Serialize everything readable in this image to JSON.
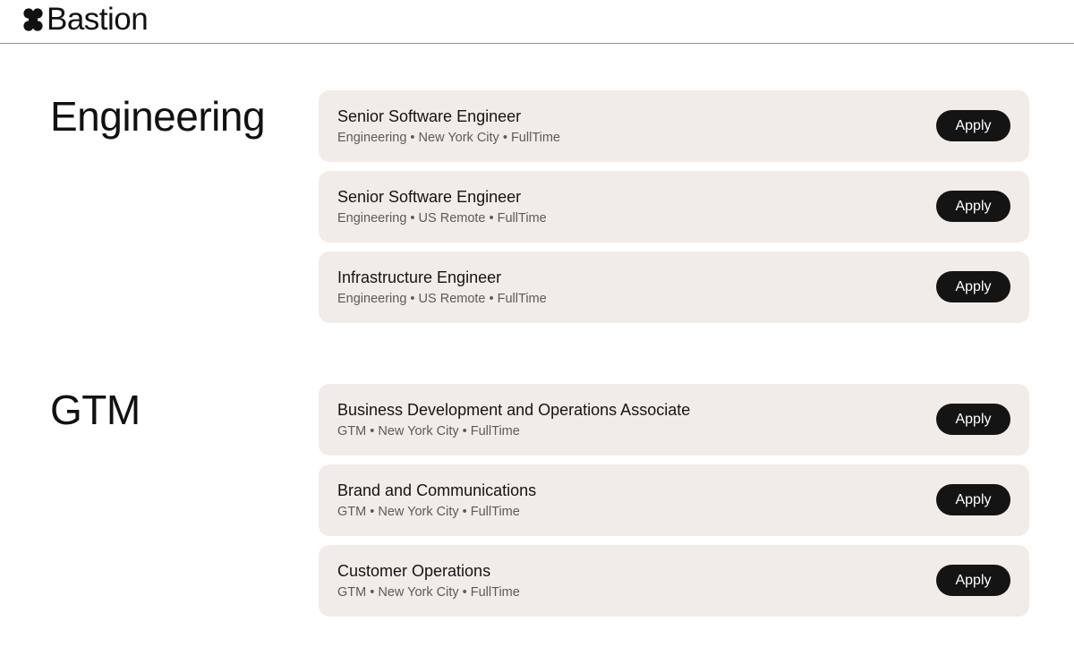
{
  "header": {
    "brand_name": "Bastion",
    "logo_icon": "four-petal-logo-icon"
  },
  "sections": [
    {
      "title": "Engineering",
      "jobs": [
        {
          "title": "Senior Software Engineer",
          "department": "Engineering",
          "location": "New York City",
          "type": "FullTime",
          "apply_label": "Apply"
        },
        {
          "title": "Senior Software Engineer",
          "department": "Engineering",
          "location": "US Remote",
          "type": "FullTime",
          "apply_label": "Apply"
        },
        {
          "title": "Infrastructure Engineer",
          "department": "Engineering",
          "location": "US Remote",
          "type": "FullTime",
          "apply_label": "Apply"
        }
      ]
    },
    {
      "title": "GTM",
      "jobs": [
        {
          "title": "Business Development and Operations Associate",
          "department": "GTM",
          "location": "New York City",
          "type": "FullTime",
          "apply_label": "Apply"
        },
        {
          "title": "Brand and Communications",
          "department": "GTM",
          "location": "New York City",
          "type": "FullTime",
          "apply_label": "Apply"
        },
        {
          "title": "Customer Operations",
          "department": "GTM",
          "location": "New York City",
          "type": "FullTime",
          "apply_label": "Apply"
        }
      ]
    }
  ],
  "meta_separator": " • ",
  "colors": {
    "card_background": "#f2ece9",
    "button_background": "#141414",
    "button_text": "#ffffff",
    "meta_text": "#5b5b5b"
  }
}
